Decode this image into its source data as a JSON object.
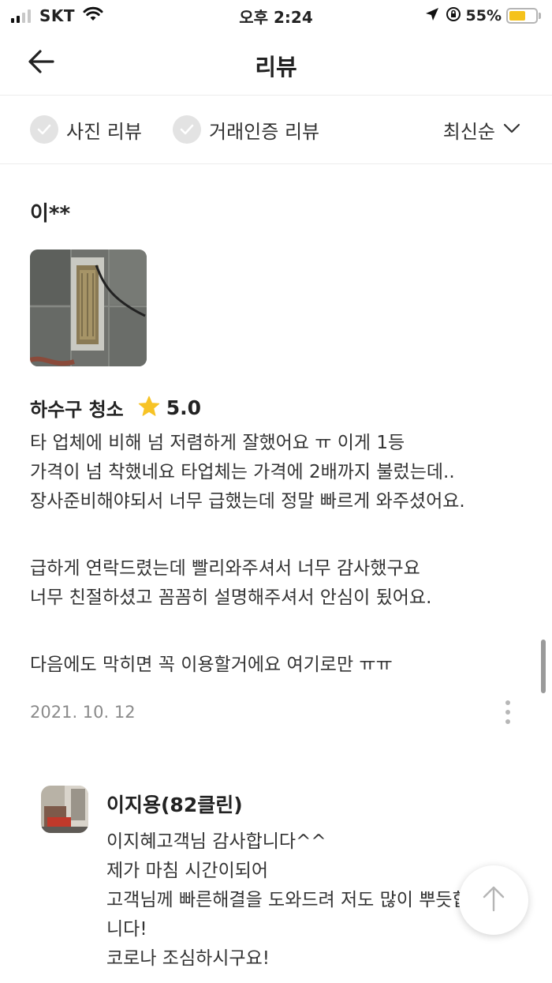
{
  "status_bar": {
    "carrier": "SKT",
    "time": "오후 2:24",
    "battery_percent": "55%",
    "battery_color": "#f5c21b"
  },
  "nav": {
    "title": "리뷰",
    "back_icon": "arrow-left-icon"
  },
  "filters": {
    "photo_review_label": "사진 리뷰",
    "verified_review_label": "거래인증 리뷰",
    "sort_label": "최신순"
  },
  "review": {
    "author": "이**",
    "service": "하수구 청소",
    "rating": "5.0",
    "star_color": "#f7c325",
    "text_lines": [
      "타 업체에 비해 넘 저렴하게 잘했어요 ㅠ 이게 1등",
      "가격이 넘 착했네요 타업체는 가격에 2배까지 불렀는데..",
      "장사준비해야되서 너무 급했는데 정말 빠르게 와주셨어요.",
      "",
      "급하게 연락드렸는데 빨리와주셔서 너무 감사했구요",
      "너무 친절하셨고 꼼꼼히 설명해주셔서 안심이 됬어요.",
      "",
      "다음에도 막히면 꼭 이용할거에요 여기로만 ㅠㅠ"
    ],
    "date": "2021. 10. 12"
  },
  "reply": {
    "author": "이지용(82클린)",
    "text_lines": [
      "이지혜고객님 감사합니다^^",
      "제가 마침 시간이되어",
      "고객님께 빠른해결을 도와드려 저도 많이 뿌듯합",
      "니다!",
      "코로나 조심하시구요!"
    ]
  }
}
